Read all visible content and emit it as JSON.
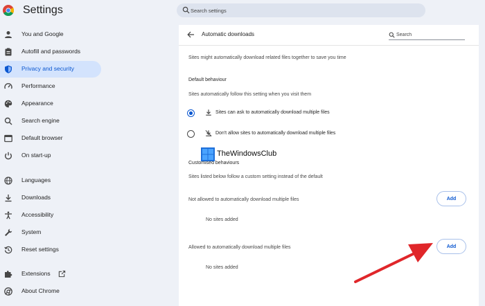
{
  "header": {
    "title": "Settings",
    "search_placeholder": "Search settings"
  },
  "sidebar": {
    "items": [
      {
        "label": "You and Google",
        "icon": "person-icon"
      },
      {
        "label": "Autofill and passwords",
        "icon": "clipboard-icon"
      },
      {
        "label": "Privacy and security",
        "icon": "shield-icon",
        "active": true
      },
      {
        "label": "Performance",
        "icon": "gauge-icon"
      },
      {
        "label": "Appearance",
        "icon": "palette-icon"
      },
      {
        "label": "Search engine",
        "icon": "search-icon"
      },
      {
        "label": "Default browser",
        "icon": "browser-icon"
      },
      {
        "label": "On start-up",
        "icon": "power-icon"
      },
      {
        "label": "Languages",
        "icon": "globe-icon"
      },
      {
        "label": "Downloads",
        "icon": "download-icon"
      },
      {
        "label": "Accessibility",
        "icon": "accessibility-icon"
      },
      {
        "label": "System",
        "icon": "wrench-icon"
      },
      {
        "label": "Reset settings",
        "icon": "history-icon"
      },
      {
        "label": "Extensions",
        "icon": "puzzle-icon"
      },
      {
        "label": "About Chrome",
        "icon": "chrome-icon"
      }
    ]
  },
  "panel": {
    "title": "Automatic downloads",
    "search_placeholder": "Search",
    "description": "Sites might automatically download related files together to save you time",
    "default_heading": "Default behaviour",
    "default_sub": "Sites automatically follow this setting when you visit them",
    "option_allow": "Sites can ask to automatically download multiple files",
    "option_block": "Don't allow sites to automatically download multiple files",
    "custom_heading": "Customised behaviours",
    "custom_sub": "Sites listed below follow a custom setting instead of the default",
    "not_allowed_label": "Not allowed to automatically download multiple files",
    "allowed_label": "Allowed to automatically download multiple files",
    "add_label": "Add",
    "no_sites": "No sites added"
  },
  "watermark": {
    "text": "TheWindowsClub"
  },
  "colors": {
    "accent": "#0b57d0",
    "active_bg": "#d3e3fd",
    "page_bg": "#eef1f7",
    "annotation_arrow": "#e0262a"
  }
}
